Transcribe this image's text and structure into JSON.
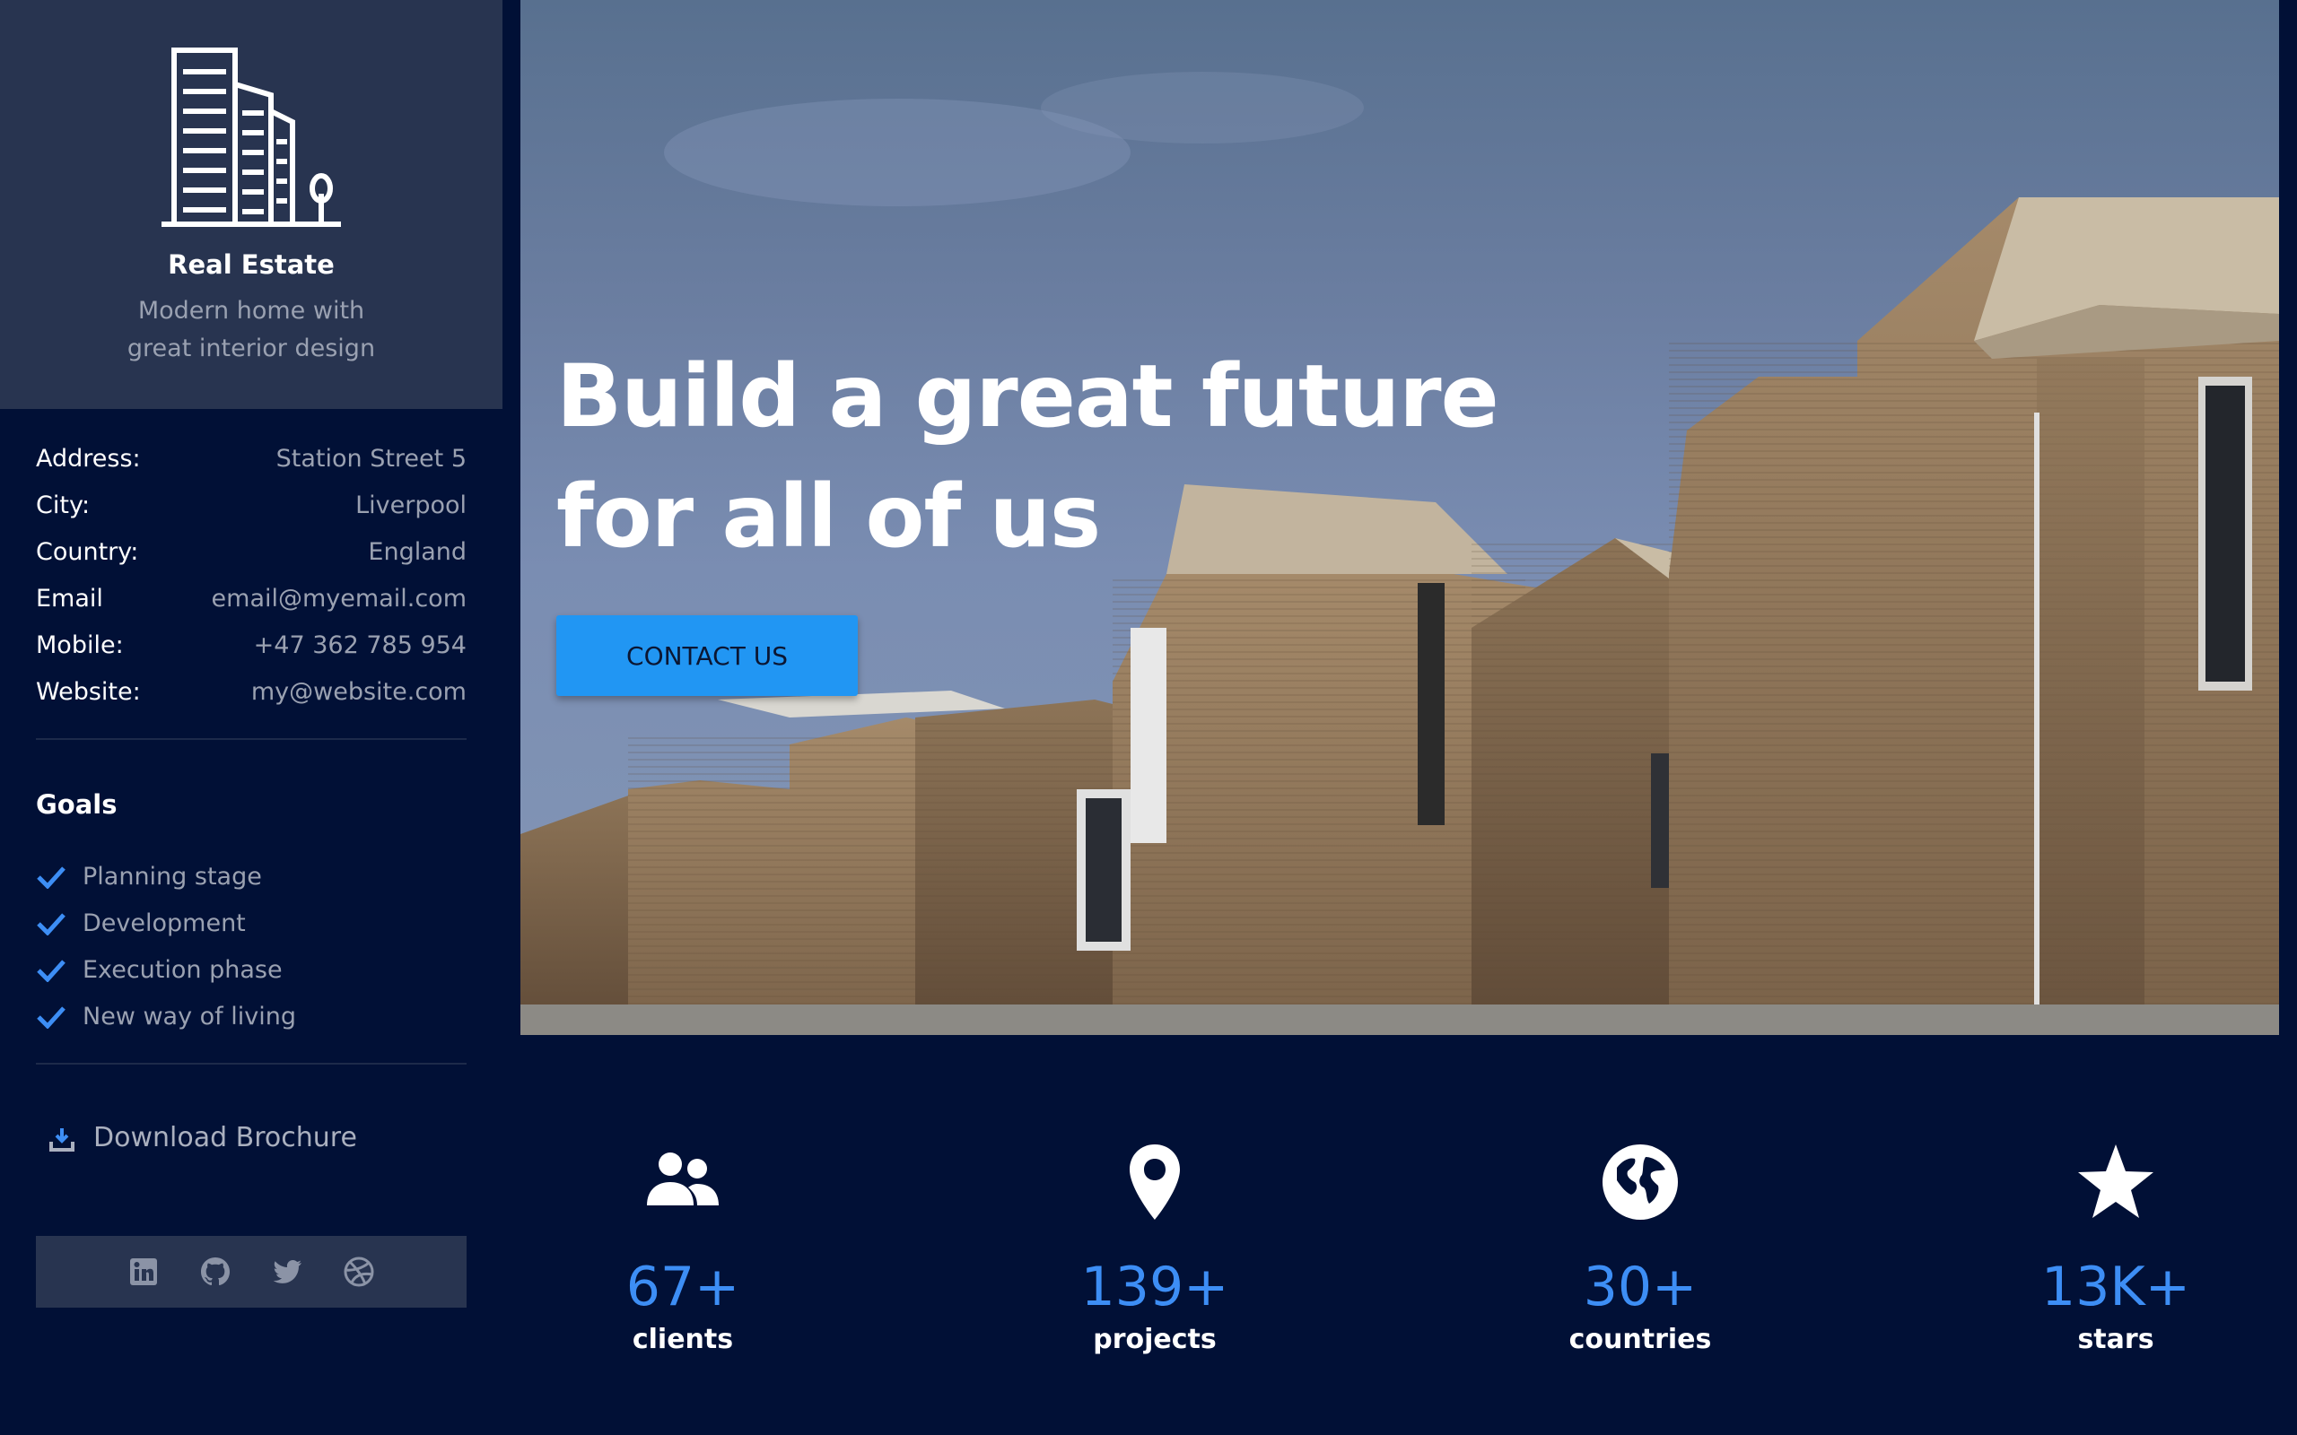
{
  "brand": {
    "title": "Real Estate",
    "subtitle": "Modern home with great interior design",
    "logo_icon": "buildings-icon"
  },
  "info": [
    {
      "label": "Address:",
      "value": "Station Street 5"
    },
    {
      "label": "City:",
      "value": "Liverpool"
    },
    {
      "label": "Country:",
      "value": "England"
    },
    {
      "label": "Email",
      "value": "email@myemail.com"
    },
    {
      "label": "Mobile:",
      "value": "+47 362 785 954"
    },
    {
      "label": "Website:",
      "value": "my@website.com"
    }
  ],
  "goals": {
    "heading": "Goals",
    "items": [
      "Planning stage",
      "Development",
      "Execution phase",
      "New way of living"
    ],
    "check_color": "#3d8ef5"
  },
  "download": {
    "label": "Download Brochure",
    "icon": "download-icon"
  },
  "social": [
    "linkedin-icon",
    "github-icon",
    "twitter-icon",
    "dribbble-icon"
  ],
  "hero": {
    "title_line1": "Build a great future",
    "title_line2": "for all of us",
    "cta_label": "CONTACT US",
    "accent": "#2196f3"
  },
  "stats": [
    {
      "value": "67+",
      "label": "clients",
      "icon": "people-icon"
    },
    {
      "value": "139+",
      "label": "projects",
      "icon": "map-pin-icon"
    },
    {
      "value": "30+",
      "label": "countries",
      "icon": "globe-icon"
    },
    {
      "value": "13K+",
      "label": "stars",
      "icon": "star-icon"
    }
  ],
  "colors": {
    "background": "#011036",
    "card": "#283450",
    "stat_value": "#3d8ef5"
  }
}
